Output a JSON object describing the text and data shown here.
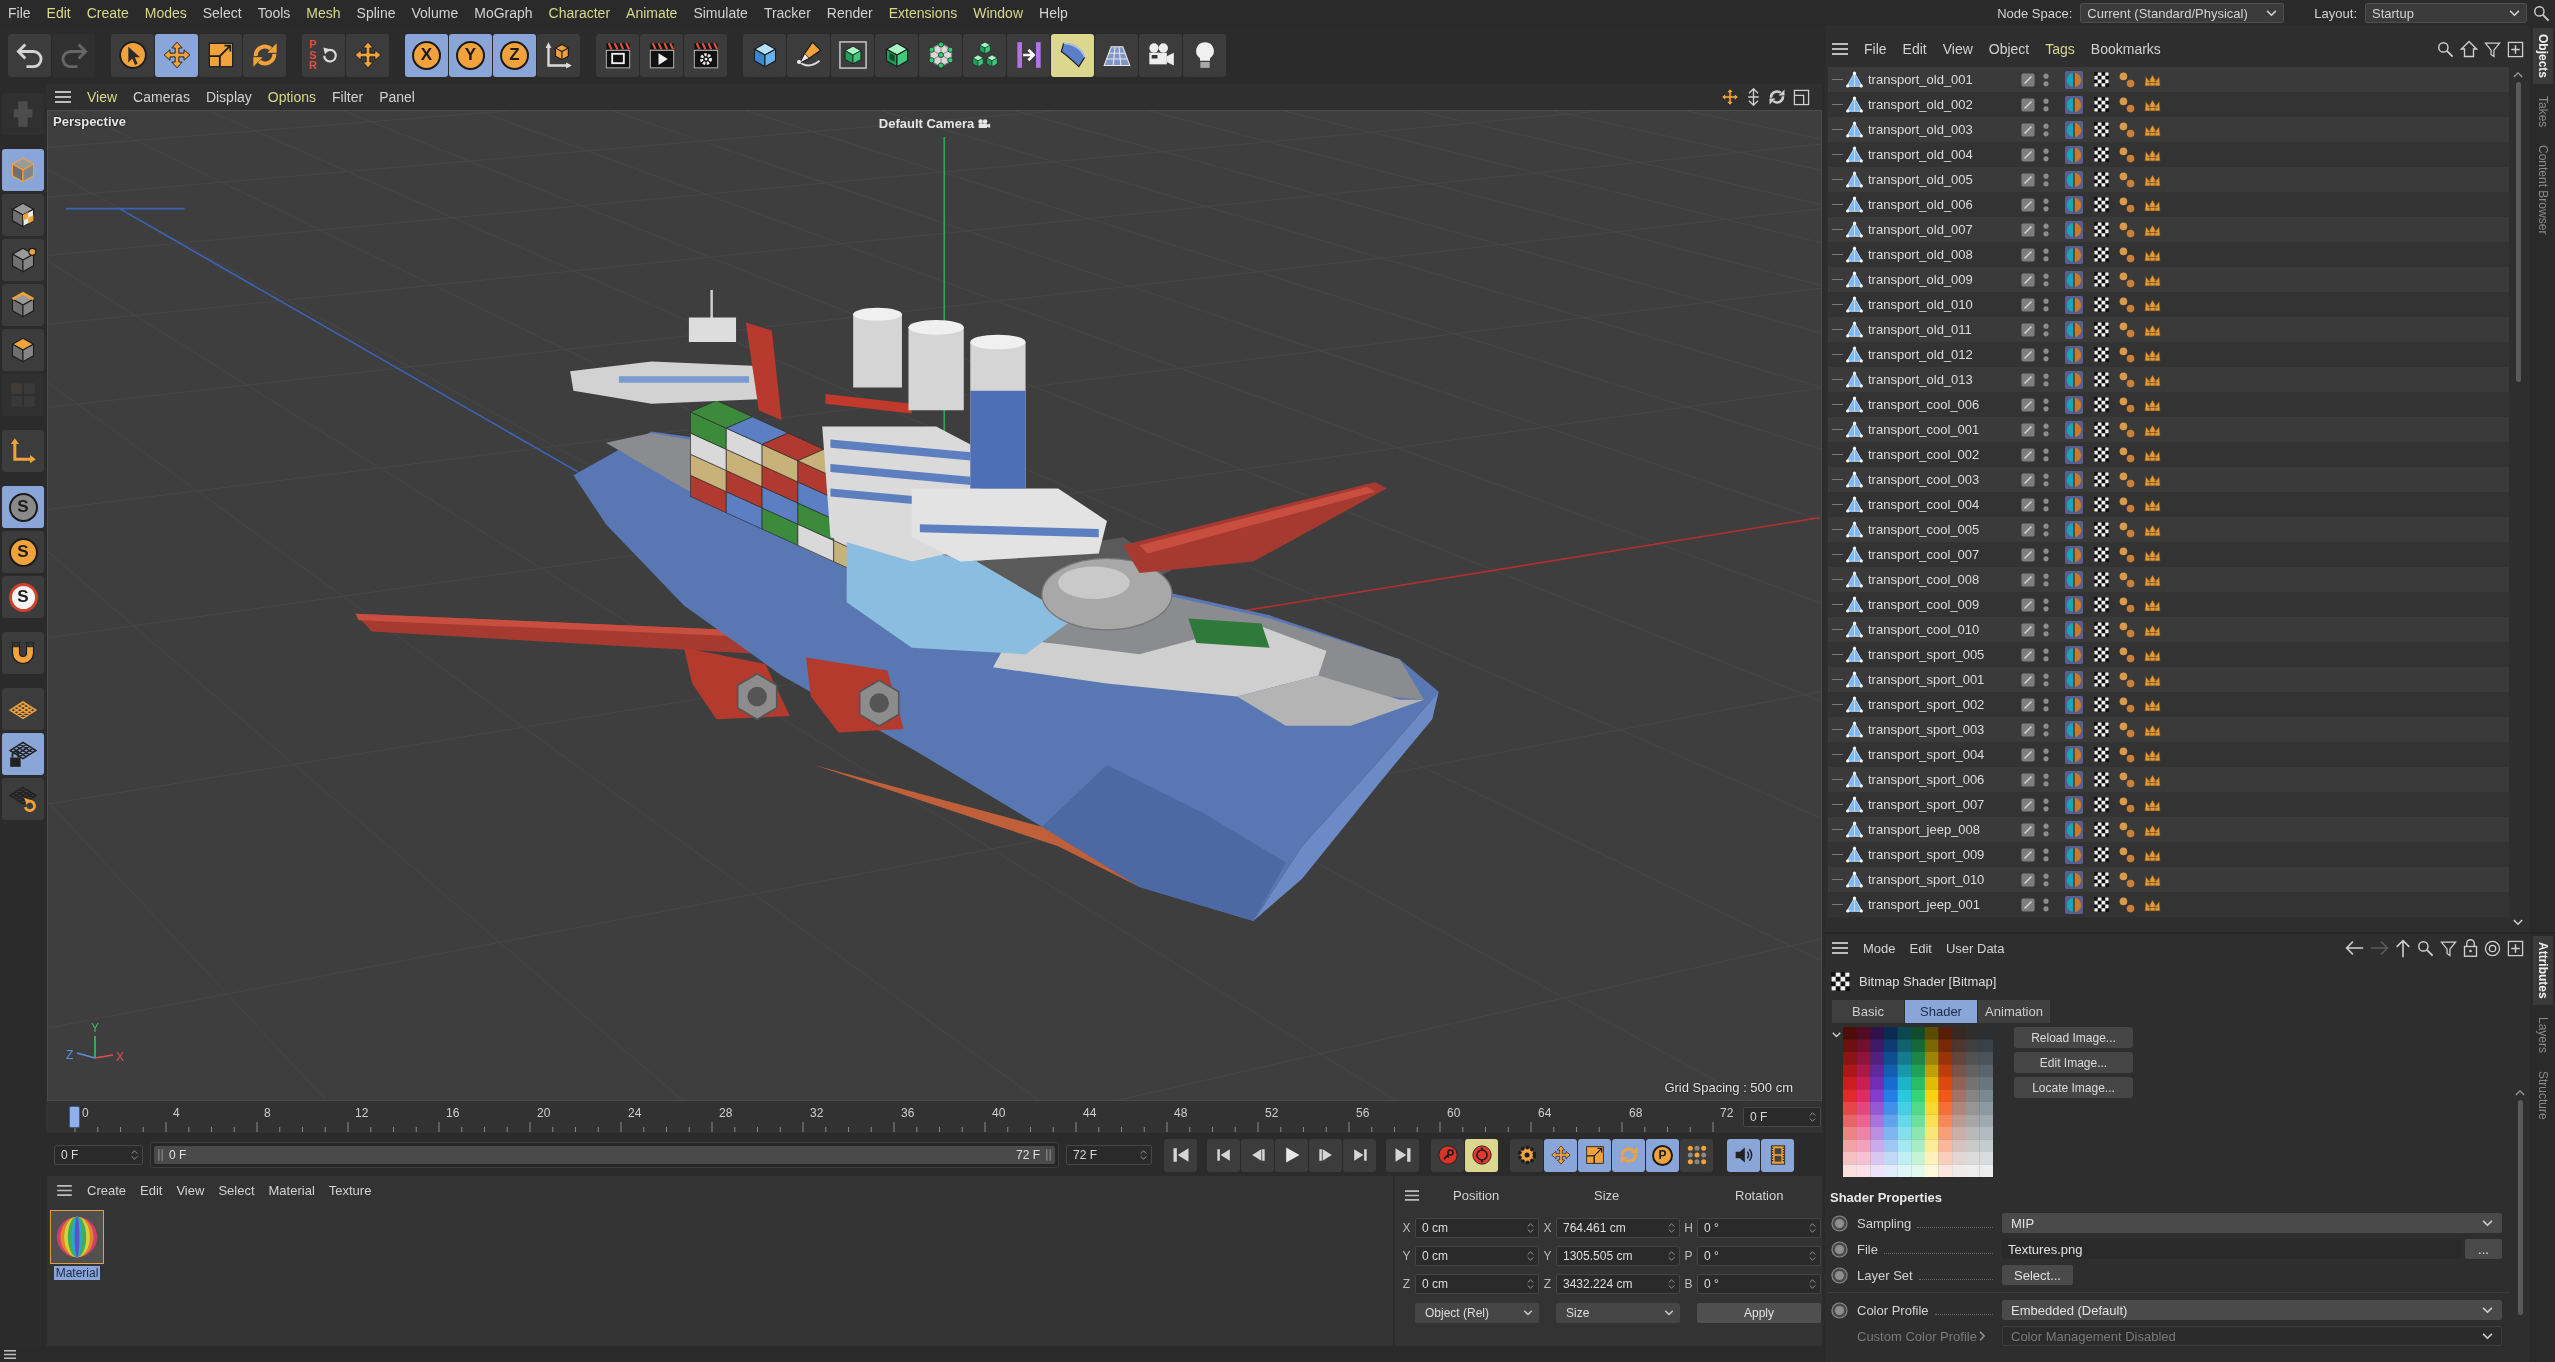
{
  "menu_bar": {
    "items": [
      {
        "label": "File",
        "highlighted": false
      },
      {
        "label": "Edit",
        "highlighted": true
      },
      {
        "label": "Create",
        "highlighted": true
      },
      {
        "label": "Modes",
        "highlighted": true
      },
      {
        "label": "Select",
        "highlighted": false
      },
      {
        "label": "Tools",
        "highlighted": false
      },
      {
        "label": "Mesh",
        "highlighted": true
      },
      {
        "label": "Spline",
        "highlighted": false
      },
      {
        "label": "Volume",
        "highlighted": false
      },
      {
        "label": "MoGraph",
        "highlighted": false
      },
      {
        "label": "Character",
        "highlighted": true
      },
      {
        "label": "Animate",
        "highlighted": true
      },
      {
        "label": "Simulate",
        "highlighted": false
      },
      {
        "label": "Tracker",
        "highlighted": false
      },
      {
        "label": "Render",
        "highlighted": false
      },
      {
        "label": "Extensions",
        "highlighted": true
      },
      {
        "label": "Window",
        "highlighted": true
      },
      {
        "label": "Help",
        "highlighted": false
      }
    ],
    "node_space": {
      "label": "Node Space:",
      "value": "Current (Standard/Physical)"
    },
    "layout": {
      "label": "Layout:",
      "value": "Startup"
    }
  },
  "toolbar": {
    "groups": [
      [
        {
          "kind": "undo",
          "selected": false,
          "highlighted": false,
          "disabled": false
        },
        {
          "kind": "redo",
          "selected": false,
          "highlighted": false,
          "disabled": true
        }
      ],
      [
        {
          "kind": "select",
          "selected": false,
          "highlighted": false,
          "disabled": false
        },
        {
          "kind": "move",
          "selected": true,
          "highlighted": false,
          "disabled": false
        },
        {
          "kind": "scale",
          "selected": false,
          "highlighted": false,
          "disabled": false
        },
        {
          "kind": "rotate",
          "selected": false,
          "highlighted": false,
          "disabled": false
        }
      ],
      [
        {
          "kind": "psr",
          "label": "PSR",
          "selected": false,
          "highlighted": false,
          "disabled": false
        },
        {
          "kind": "move",
          "selected": false,
          "highlighted": false,
          "disabled": false
        }
      ],
      [
        {
          "kind": "axis",
          "label": "X",
          "selected": true,
          "highlighted": false,
          "disabled": false
        },
        {
          "kind": "axis",
          "label": "Y",
          "selected": true,
          "highlighted": false,
          "disabled": false
        },
        {
          "kind": "axis",
          "label": "Z",
          "selected": true,
          "highlighted": false,
          "disabled": false
        },
        {
          "kind": "coord",
          "selected": false,
          "highlighted": false,
          "disabled": false
        }
      ],
      [
        {
          "kind": "render_region",
          "selected": false,
          "highlighted": false,
          "disabled": false
        },
        {
          "kind": "render_view",
          "selected": false,
          "highlighted": false,
          "disabled": false
        },
        {
          "kind": "render_settings",
          "selected": false,
          "highlighted": false,
          "disabled": false
        }
      ],
      [
        {
          "kind": "cube",
          "selected": false,
          "highlighted": false,
          "disabled": false
        },
        {
          "kind": "pen",
          "selected": false,
          "highlighted": false,
          "disabled": false
        },
        {
          "kind": "cage_cube",
          "selected": false,
          "highlighted": false,
          "disabled": false
        },
        {
          "kind": "hollow_cube",
          "selected": false,
          "highlighted": false,
          "disabled": false
        },
        {
          "kind": "node_sphere",
          "selected": false,
          "highlighted": false,
          "disabled": false
        },
        {
          "kind": "cubes",
          "selected": false,
          "highlighted": false,
          "disabled": false
        },
        {
          "kind": "bend",
          "selected": false,
          "highlighted": false,
          "disabled": false
        },
        {
          "kind": "field",
          "selected": false,
          "highlighted": true,
          "disabled": false
        },
        {
          "kind": "floor",
          "selected": false,
          "highlighted": false,
          "disabled": false
        },
        {
          "kind": "camera",
          "selected": false,
          "highlighted": false,
          "disabled": false
        },
        {
          "kind": "light",
          "selected": false,
          "highlighted": false,
          "disabled": false
        }
      ]
    ]
  },
  "left_toolbar": {
    "groups": [
      [
        {
          "kind": "model",
          "selected": false,
          "disabled": true
        }
      ],
      [
        {
          "kind": "object_mode",
          "selected": true,
          "disabled": false
        },
        {
          "kind": "texture",
          "selected": false,
          "disabled": false
        },
        {
          "kind": "points",
          "selected": false,
          "disabled": false
        },
        {
          "kind": "edges",
          "selected": false,
          "disabled": false
        },
        {
          "kind": "polygons",
          "selected": false,
          "disabled": false
        },
        {
          "kind": "uv",
          "selected": false,
          "disabled": true
        }
      ],
      [
        {
          "kind": "axis_mode",
          "selected": false,
          "disabled": false
        }
      ],
      [
        {
          "kind": "snap",
          "label": "S",
          "selected": true,
          "disabled": false
        },
        {
          "kind": "snap_solid",
          "label": "S",
          "selected": false,
          "disabled": false
        },
        {
          "kind": "snap_ring",
          "label": "S",
          "selected": false,
          "disabled": false
        }
      ],
      [
        {
          "kind": "magnet",
          "selected": false,
          "disabled": false
        }
      ],
      [
        {
          "kind": "workplane",
          "selected": false,
          "disabled": false
        },
        {
          "kind": "workplane_lock",
          "selected": true,
          "disabled": false
        },
        {
          "kind": "workplane_rotate",
          "selected": false,
          "disabled": false
        }
      ]
    ]
  },
  "viewport": {
    "menu": [
      {
        "label": "View",
        "highlighted": true
      },
      {
        "label": "Cameras",
        "highlighted": false
      },
      {
        "label": "Display",
        "highlighted": false
      },
      {
        "label": "Options",
        "highlighted": true
      },
      {
        "label": "Filter",
        "highlighted": false
      },
      {
        "label": "Panel",
        "highlighted": false
      }
    ],
    "view_name": "Perspective",
    "camera": "Default Camera",
    "grid_spacing": "Grid Spacing : 500 cm",
    "axis_labels": [
      "Y",
      "Z",
      "X"
    ]
  },
  "timeline": {
    "ruler_labels": [
      "0",
      "4",
      "8",
      "12",
      "16",
      "20",
      "24",
      "28",
      "32",
      "36",
      "40",
      "44",
      "48",
      "52",
      "56",
      "60",
      "64",
      "68",
      "72"
    ],
    "playhead": {
      "level": 0
    },
    "current_frame": "0 F",
    "start_frame": "0 F",
    "range": {
      "start": "0 F",
      "end": "72 F",
      "level": 1
    },
    "end_frame": "72 F",
    "transport": [
      {
        "kind": "go_start"
      },
      {
        "kind": "key_prev"
      },
      {
        "kind": "frame_prev"
      },
      {
        "kind": "play"
      },
      {
        "kind": "frame_next"
      },
      {
        "kind": "key_next"
      },
      {
        "kind": "go_end"
      }
    ],
    "record": [
      {
        "kind": "record",
        "highlighted": false
      },
      {
        "kind": "autokey",
        "highlighted": true
      }
    ],
    "keys": [
      {
        "kind": "key_gear",
        "selected": false
      },
      {
        "kind": "key_move",
        "selected": true
      },
      {
        "kind": "key_scale",
        "selected": true
      },
      {
        "kind": "key_rotate",
        "selected": true
      },
      {
        "kind": "key_param",
        "label": "P",
        "selected": true
      },
      {
        "kind": "key_dots",
        "selected": false
      }
    ],
    "extras": [
      {
        "kind": "sound",
        "selected": true
      },
      {
        "kind": "film",
        "selected": true
      }
    ]
  },
  "material_manager": {
    "menu": [
      "Create",
      "Edit",
      "View",
      "Select",
      "Material",
      "Texture"
    ],
    "materials": [
      {
        "name": "Material",
        "selected": true
      }
    ]
  },
  "coordinates": {
    "headers": [
      "Position",
      "Size",
      "Rotation"
    ],
    "rows": [
      {
        "position_axis": "X",
        "position": "0 cm",
        "size_axis": "X",
        "size": "764.461 cm",
        "rotation_axis": "H",
        "rotation": "0 °"
      },
      {
        "position_axis": "Y",
        "position": "0 cm",
        "size_axis": "Y",
        "size": "1305.505 cm",
        "rotation_axis": "P",
        "rotation": "0 °"
      },
      {
        "position_axis": "Z",
        "position": "0 cm",
        "size_axis": "Z",
        "size": "3432.224 cm",
        "rotation_axis": "B",
        "rotation": "0 °"
      }
    ],
    "mode": "Object (Rel)",
    "size_mode": "Size",
    "apply": "Apply"
  },
  "object_manager": {
    "menu": [
      {
        "label": "File",
        "highlighted": false
      },
      {
        "label": "Edit",
        "highlighted": false
      },
      {
        "label": "View",
        "highlighted": false
      },
      {
        "label": "Object",
        "highlighted": false
      },
      {
        "label": "Tags",
        "highlighted": true
      },
      {
        "label": "Bookmarks",
        "highlighted": false
      }
    ],
    "objects": [
      {
        "name": "transport_old_001"
      },
      {
        "name": "transport_old_002"
      },
      {
        "name": "transport_old_003"
      },
      {
        "name": "transport_old_004"
      },
      {
        "name": "transport_old_005"
      },
      {
        "name": "transport_old_006"
      },
      {
        "name": "transport_old_007"
      },
      {
        "name": "transport_old_008"
      },
      {
        "name": "transport_old_009"
      },
      {
        "name": "transport_old_010"
      },
      {
        "name": "transport_old_011"
      },
      {
        "name": "transport_old_012"
      },
      {
        "name": "transport_old_013"
      },
      {
        "name": "transport_cool_006"
      },
      {
        "name": "transport_cool_001"
      },
      {
        "name": "transport_cool_002"
      },
      {
        "name": "transport_cool_003"
      },
      {
        "name": "transport_cool_004"
      },
      {
        "name": "transport_cool_005"
      },
      {
        "name": "transport_cool_007"
      },
      {
        "name": "transport_cool_008"
      },
      {
        "name": "transport_cool_009"
      },
      {
        "name": "transport_cool_010"
      },
      {
        "name": "transport_sport_005"
      },
      {
        "name": "transport_sport_001"
      },
      {
        "name": "transport_sport_002"
      },
      {
        "name": "transport_sport_003"
      },
      {
        "name": "transport_sport_004"
      },
      {
        "name": "transport_sport_006"
      },
      {
        "name": "transport_sport_007"
      },
      {
        "name": "transport_jeep_008"
      },
      {
        "name": "transport_sport_009"
      },
      {
        "name": "transport_sport_010"
      },
      {
        "name": "transport_jeep_001"
      }
    ],
    "side_tabs": [
      {
        "label": "Objects",
        "selected": true
      },
      {
        "label": "Takes",
        "selected": false
      },
      {
        "label": "Content Browser",
        "selected": false
      }
    ]
  },
  "attributes": {
    "menu": [
      "Mode",
      "Edit",
      "User Data"
    ],
    "title": "Bitmap Shader [Bitmap]",
    "tabs": [
      {
        "label": "Basic",
        "selected": false
      },
      {
        "label": "Shader",
        "selected": true
      },
      {
        "label": "Animation",
        "selected": false
      }
    ],
    "buttons": [
      "Reload Image...",
      "Edit Image...",
      "Locate Image..."
    ],
    "section": "Shader Properties",
    "property_groups": [
      [
        {
          "kind": "dropdown",
          "label": "Sampling",
          "value": "MIP",
          "disabled": false
        },
        {
          "kind": "file",
          "label": "File",
          "value": "Textures.png",
          "button": "...",
          "disabled": false
        },
        {
          "kind": "button",
          "label": "Layer Set",
          "value": "Select...",
          "disabled": false
        }
      ],
      [
        {
          "kind": "dropdown",
          "label": "Color Profile",
          "value": "Embedded (Default)",
          "disabled": false
        },
        {
          "kind": "dropdown",
          "label": "Custom Color Profile",
          "value": "Color Management Disabled",
          "disabled": true
        }
      ]
    ],
    "side_tabs": [
      {
        "label": "Attributes",
        "selected": true
      },
      {
        "label": "Layers",
        "selected": false
      },
      {
        "label": "Structure",
        "selected": false
      }
    ]
  }
}
